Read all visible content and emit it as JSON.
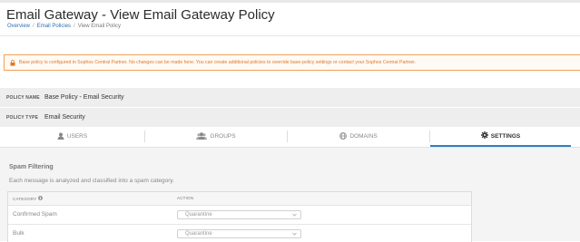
{
  "header": {
    "title": "Email Gateway - View Email Gateway Policy",
    "breadcrumb": [
      "Overview",
      "Email Policies",
      "View Email Policy"
    ]
  },
  "alert": {
    "icon": "lock-icon",
    "text": "Base policy is configured in Sophos Central Partner. No changes can be made here. You can create additional policies to override base-policy settings or contact your Sophos Central Partner."
  },
  "policy": {
    "name_label": "POLICY NAME",
    "name_value": "Base Policy - Email Security",
    "type_label": "POLICY TYPE",
    "type_value": "Email Security"
  },
  "tabs": [
    {
      "label": "USERS",
      "icon": "user-icon"
    },
    {
      "label": "GROUPS",
      "icon": "group-icon"
    },
    {
      "label": "DOMAINS",
      "icon": "globe-icon"
    },
    {
      "label": "SETTINGS",
      "icon": "gear-icon",
      "active": true
    }
  ],
  "spam": {
    "title": "Spam Filtering",
    "description": "Each message is analyzed and classified into a spam category.",
    "columns": [
      "CATEGORY",
      "ACTION"
    ],
    "rows": [
      {
        "category": "Confirmed Spam",
        "action": "Quarantine"
      },
      {
        "category": "Bulk",
        "action": "Quarantine"
      }
    ]
  },
  "colors": {
    "accent": "#2f7fc1",
    "warning": "#e0782a",
    "link": "#2f6fb2"
  }
}
